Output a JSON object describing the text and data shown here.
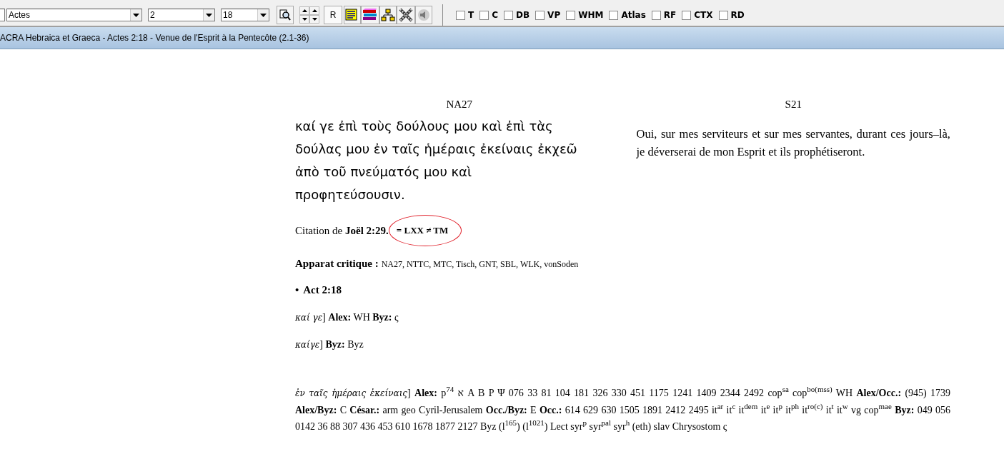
{
  "toolbar": {
    "book": "Actes",
    "chapter": "2",
    "verse": "18",
    "reference_button": "R",
    "checkboxes": [
      {
        "label": "T",
        "checked": false
      },
      {
        "label": "C",
        "checked": false
      },
      {
        "label": "DB",
        "checked": false
      },
      {
        "label": "VP",
        "checked": false
      },
      {
        "label": "WHM",
        "checked": false
      },
      {
        "label": "Atlas",
        "checked": false
      },
      {
        "label": "RF",
        "checked": false
      },
      {
        "label": "CTX",
        "checked": false
      },
      {
        "label": "RD",
        "checked": false
      }
    ]
  },
  "title_bar": {
    "title": "ACRA Hebraica et Graeca - Actes 2:18 - Venue de l'Esprit à la Pentecôte (2.1-36)"
  },
  "columns": [
    {
      "header": "NA27",
      "text": "καί γε ἐπὶ τοὺς δούλους μου καὶ ἐπὶ τὰς δούλας μου ἐν ταῖς ἡμέραις ἐκείναις ἐκχεῶ ἀπὸ τοῦ πνεύματός μου καὶ προφητεύσουσιν."
    },
    {
      "header": "S21",
      "text": "Oui, sur mes serviteurs et sur mes servantes, durant ces jours–là, je déverserai de mon Esprit et ils prophétiseront."
    }
  ],
  "citation": {
    "text": "Citation de **Joël 2:29.**",
    "annotation": "= LXX ≠ TM"
  },
  "apparatus": {
    "heading": "Apparat critique :",
    "sources": "NA27, NTTC, MTC, Tisch, GNT, SBL, WLK, vonSoden"
  },
  "verse_heading": {
    "bullet": "•",
    "reference": "Act 2:18"
  },
  "variants": [
    {
      "text": "*καί γε*] **Alex:** WH **Byz:** ς"
    },
    {
      "text": "*καίγε*] **Byz:** Byz"
    },
    {
      "text": "*ἐν ταῖς ἡμέραις ἐκείναις*] **Alex:** p$^{74}$ א A B P Ψ 076 33 81 104 181 326 330 451 1175 1241 1409 2344 2492 cop$^{sa}$ cop$^{bo(mss)}$ WH **Alex/Occ.:** (945) 1739 **Alex/Byz:** C **César.:** arm geo Cyril-Jerusalem **Occ./Byz:** E **Occ.:** 614 629 630 1505 1891 2412 2495 it$^{ar}$ it$^{c}$ it$^{dem}$ it$^{e}$ it$^{p}$ it$^{ph}$ it$^{ro(c)}$ it$^{t}$ it$^{w}$ vg cop$^{mae}$ **Byz:** 049 056 0142 36 88 307 436 453 610 1678 1877 2127 Byz (l$^{165}$) (l$^{1021}$) Lect syr$^{p}$ syr$^{pal}$ syr$^{h}$ (eth) slav Chrysostom ς"
    }
  ]
}
